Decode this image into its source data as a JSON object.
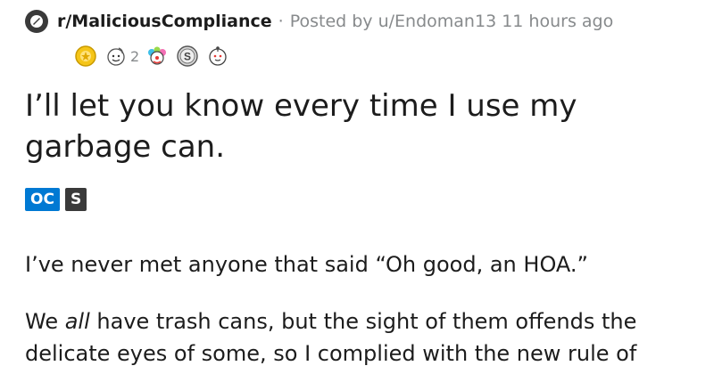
{
  "post": {
    "subreddit": "r/MaliciousCompliance",
    "separator": "·",
    "posted_by_prefix": "Posted by",
    "author": "u/Endoman13",
    "time_ago": "11 hours ago",
    "awards": [
      {
        "icon": "gold-award-icon"
      },
      {
        "icon": "wholesome-award-icon",
        "count": "2"
      },
      {
        "icon": "clown-award-icon"
      },
      {
        "icon": "silver-s-award-icon"
      },
      {
        "icon": "hugz-award-icon"
      }
    ],
    "title_line1": "I’ll let you know every time I use my",
    "title_line2": "garbage can.",
    "flairs": [
      "OC",
      "S"
    ],
    "paragraph1": "I’ve never met anyone that said “Oh good, an HOA.”",
    "paragraph2_before": "We ",
    "paragraph2_emphasis": "all",
    "paragraph2_line1_rest": " have trash cans, but the sight of them offends the",
    "paragraph2_line2": "delicate eyes of some, so I complied with the new rule of"
  },
  "colors": {
    "text": "#1c1c1c",
    "meta": "#878a8c",
    "oc_flair": "#0079d3",
    "s_flair": "#3a3a3a"
  }
}
